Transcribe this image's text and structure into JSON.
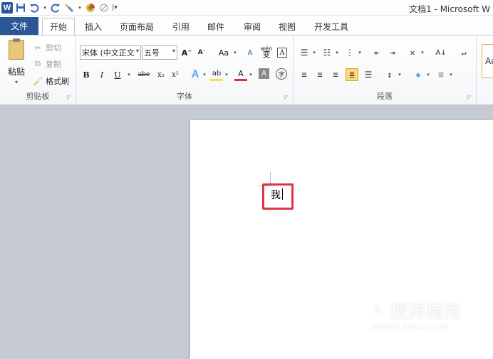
{
  "titlebar": {
    "title": "文档1 - Microsoft W",
    "qat_icons": [
      "word-logo",
      "save-icon",
      "undo-icon",
      "redo-icon",
      "format-painter-icon",
      "color-icon",
      "pen-icon",
      "customize-icon"
    ],
    "logo_letter": "W"
  },
  "tabs": {
    "file": "文件",
    "items": [
      "开始",
      "插入",
      "页面布局",
      "引用",
      "邮件",
      "审阅",
      "视图",
      "开发工具"
    ],
    "active": "开始"
  },
  "clipboard": {
    "paste_label": "粘贴",
    "cut_label": "剪切",
    "copy_label": "复制",
    "format_painter_label": "格式刷",
    "group_label": "剪贴板"
  },
  "font": {
    "font_name": "宋体 (中文正文",
    "font_size": "五号",
    "group_label": "字体",
    "grow_glyph": "A",
    "shrink_glyph": "A",
    "case_glyph": "Aa",
    "bold_glyph": "B",
    "italic_glyph": "I",
    "underline_glyph": "U",
    "strike_glyph": "abe",
    "subscript_glyph": "x₂",
    "superscript_glyph": "x²",
    "text_effect_glyph": "A",
    "highlight_glyph": "ab",
    "font_color_glyph": "A",
    "char_shading_glyph": "A",
    "enclose_glyph": "字",
    "phonetic_glyph": "wén",
    "border_glyph": "A",
    "clear_glyph": "A"
  },
  "paragraph": {
    "group_label": "段落",
    "sort_glyph": "A↓",
    "marks_glyph": "↵"
  },
  "styles": {
    "preview": "Aa"
  },
  "document": {
    "text": "我"
  },
  "watermark": {
    "main": "搜狗指南",
    "sub": "zhinan.sogou.com",
    "circle": "S"
  },
  "colors": {
    "file_tab": "#2b5797",
    "highlight_box": "#e0363f",
    "justify_active": "#fcd77b"
  }
}
